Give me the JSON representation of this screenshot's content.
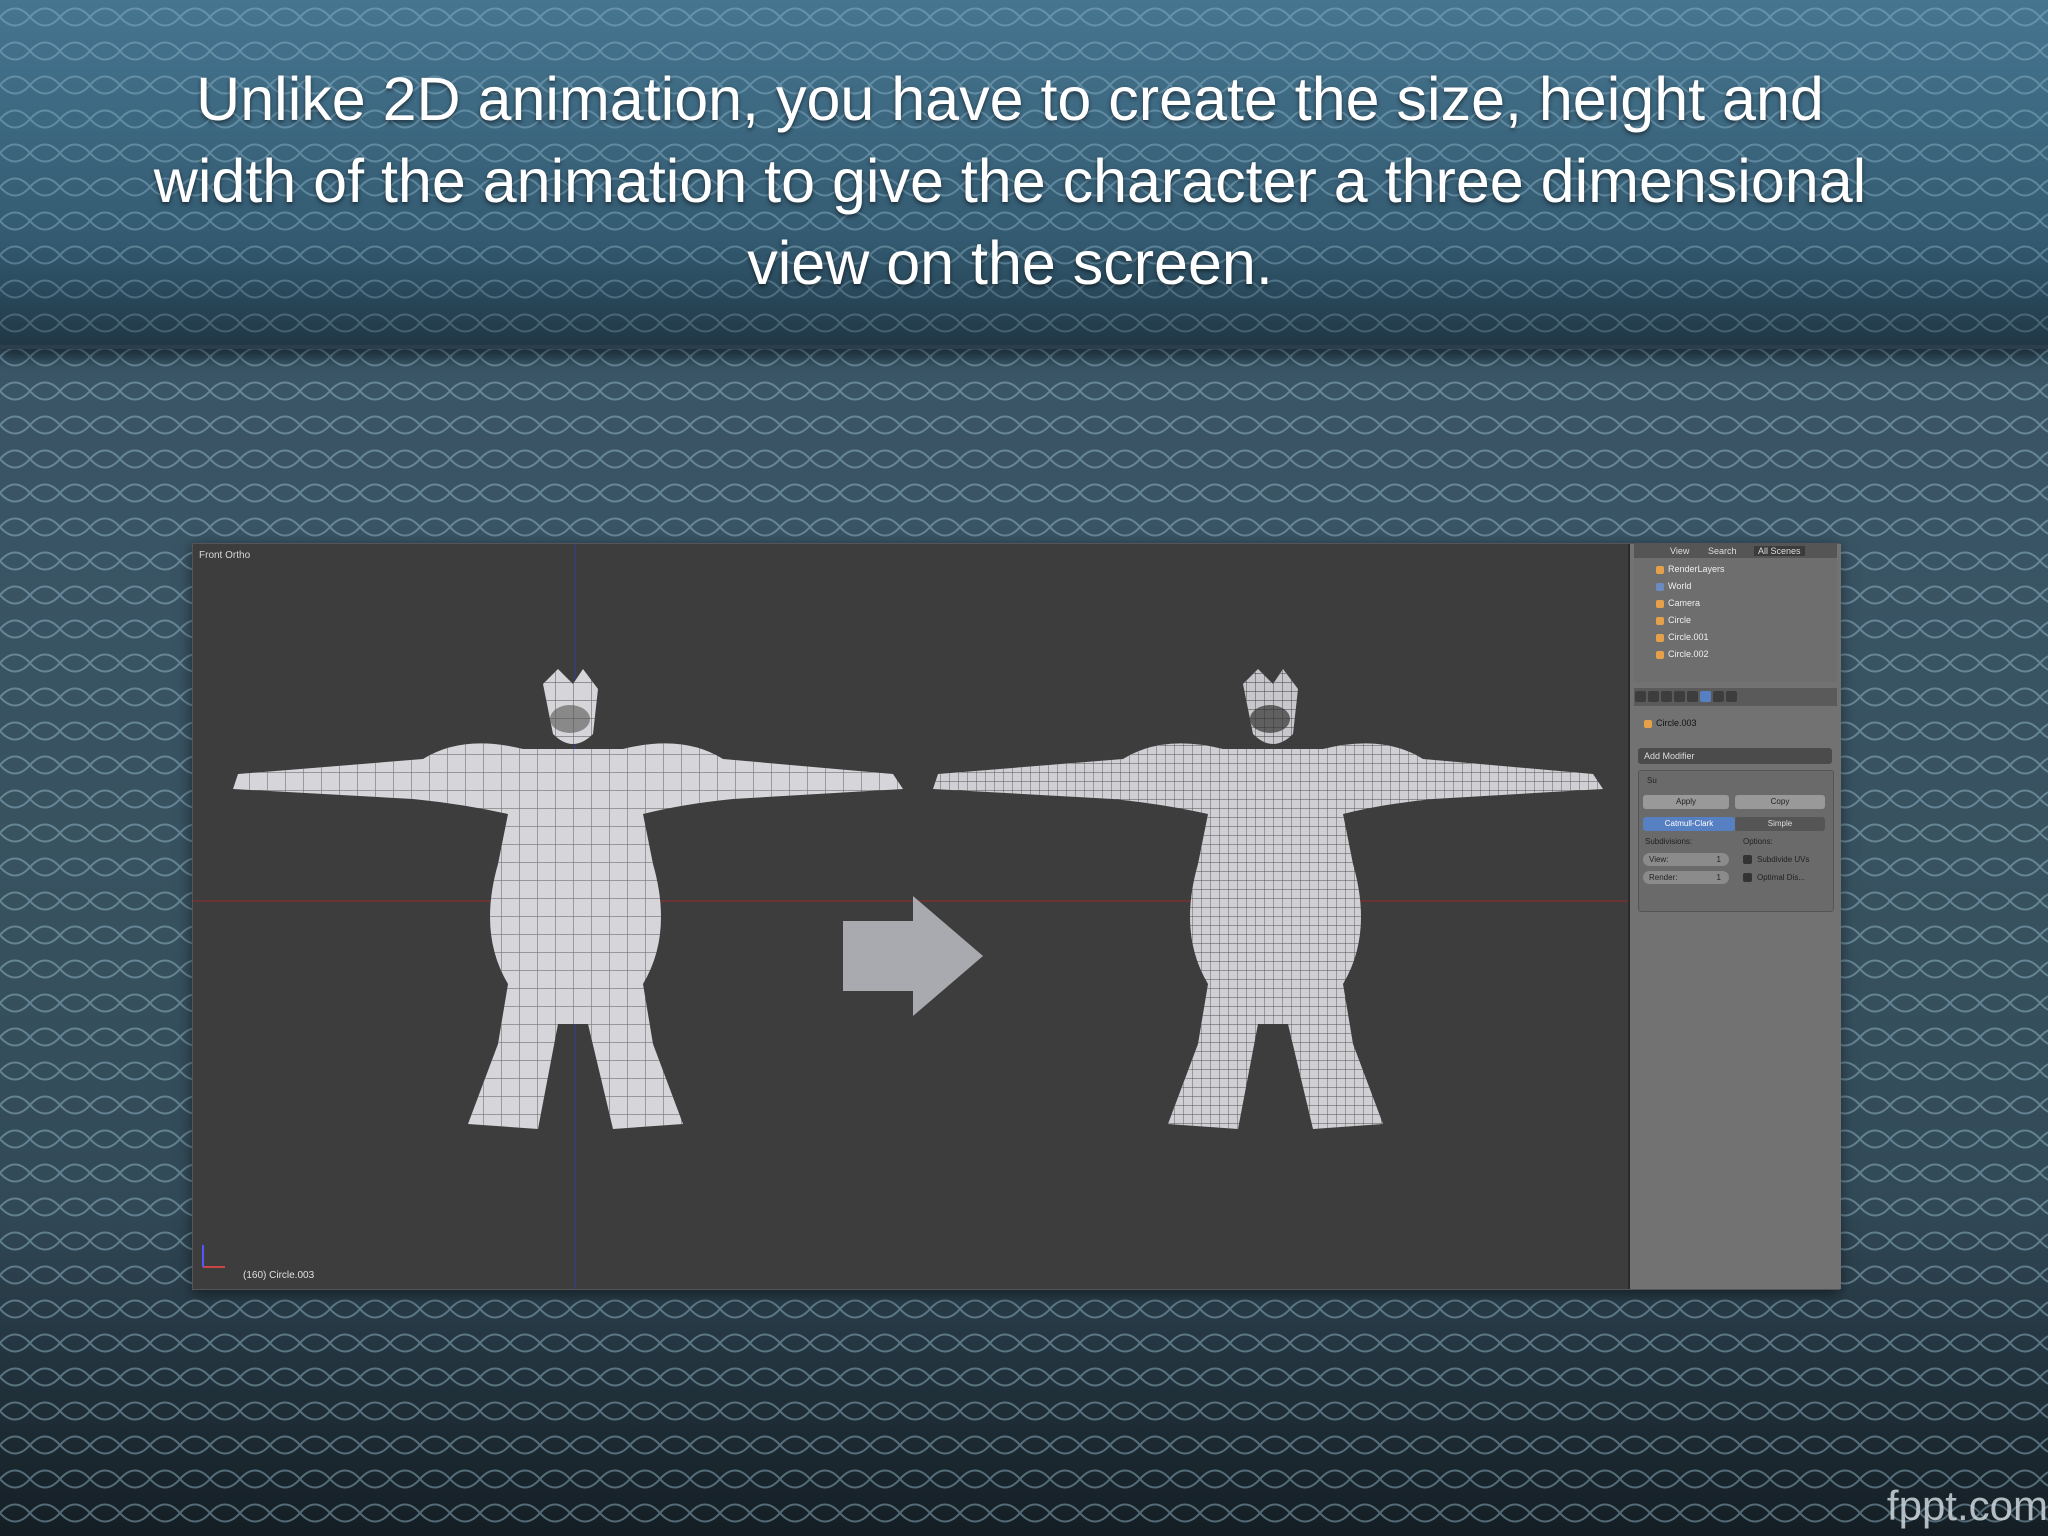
{
  "slide": {
    "title": "Unlike 2D animation, you have to create the size, height and width of the animation to give the character a three dimensional view on the screen.",
    "footer": "fppt.com"
  },
  "blender": {
    "viewport_label": "Front Ortho",
    "frame_label": "(160) Circle.003",
    "outliner": {
      "tabs": [
        "View",
        "Search",
        "All Scenes"
      ],
      "items": [
        {
          "label": "RenderLayers"
        },
        {
          "label": "World"
        },
        {
          "label": "Camera"
        },
        {
          "label": "Circle"
        },
        {
          "label": "Circle.001"
        },
        {
          "label": "Circle.002"
        }
      ]
    },
    "properties": {
      "object_name": "Circle.003",
      "add_modifier_label": "Add Modifier",
      "modifier_name": "Su",
      "apply_label": "Apply",
      "copy_label": "Copy",
      "catmull_label": "Catmull-Clark",
      "simple_label": "Simple",
      "subdivisions_label": "Subdivisions:",
      "options_label": "Options:",
      "view_label": "View:",
      "view_value": "1",
      "render_label": "Render:",
      "render_value": "1",
      "subdivide_uvs_label": "Subdivide UVs",
      "optimal_display_label": "Optimal Dis..."
    },
    "colors": {
      "viewport_bg": "#3d3d3d",
      "panel_bg": "#727272",
      "selected_blue": "#5680c2",
      "mesh": "#d6d6da"
    }
  }
}
